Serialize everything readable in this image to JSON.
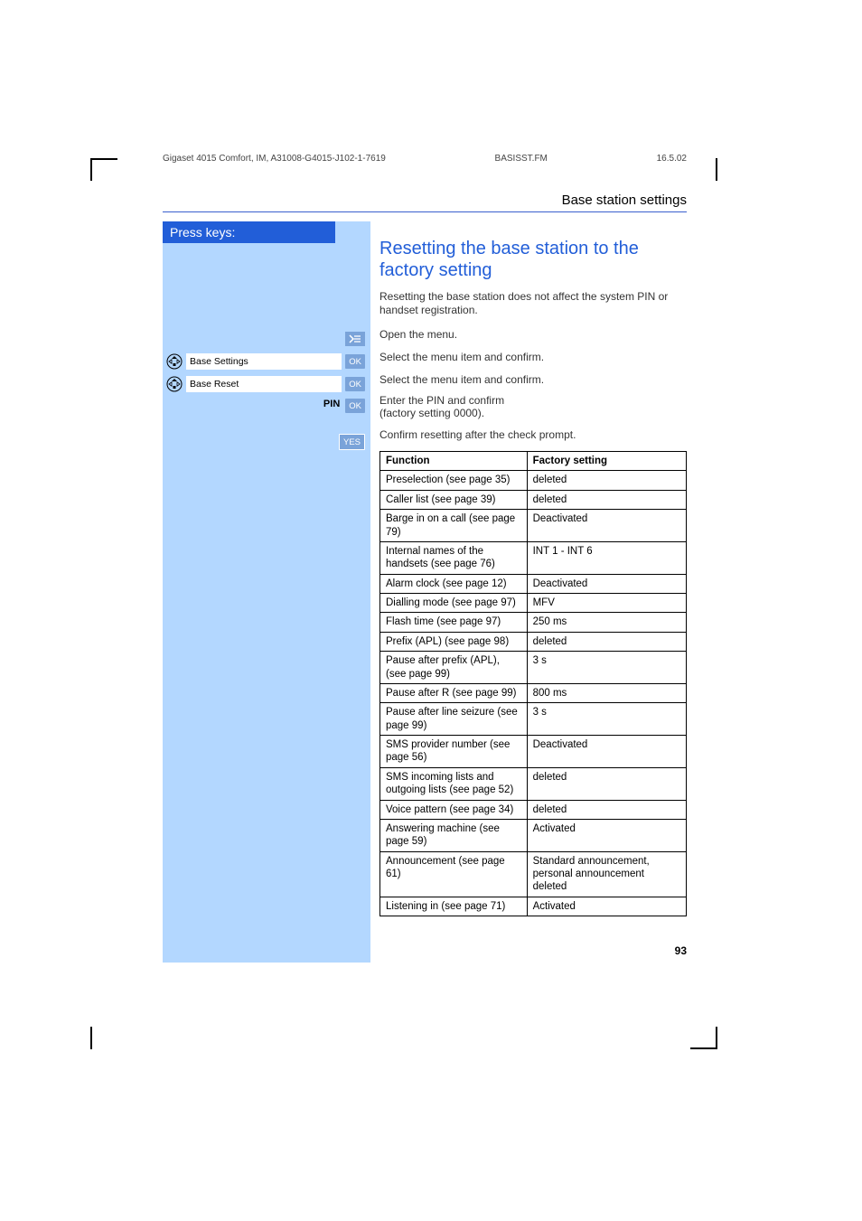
{
  "header": {
    "doc_id": "Gigaset 4015 Comfort, IM, A31008-G4015-J102-1-7619",
    "file": "BASISST.FM",
    "date": "16.5.02",
    "section_title": "Base station settings"
  },
  "sidebar": {
    "press_keys": "Press keys:",
    "steps": [
      {
        "type": "iconmenu"
      },
      {
        "type": "navfield",
        "field": "Base Settings",
        "pill": "OK"
      },
      {
        "type": "navfield",
        "field": "Base Reset",
        "pill": "OK"
      },
      {
        "type": "pin",
        "label": "PIN",
        "pill": "OK"
      },
      {
        "type": "yes",
        "pill": "YES"
      }
    ]
  },
  "main": {
    "heading": "Resetting the base station to the factory setting",
    "intro": "Resetting the base station does not affect the system PIN or handset registration.",
    "steps_text": [
      "Open the menu.",
      "Select the menu item and confirm.",
      "Select the menu item and confirm.",
      "Enter the PIN and confirm\n(factory setting 0000).",
      "Confirm resetting after the check prompt."
    ],
    "table": {
      "headers": [
        "Function",
        "Factory setting"
      ],
      "rows": [
        [
          "Preselection (see page 35)",
          "deleted"
        ],
        [
          "Caller list (see page 39)",
          "deleted"
        ],
        [
          "Barge in on a call (see page 79)",
          "Deactivated"
        ],
        [
          "Internal names of the handsets (see page 76)",
          "INT 1 - INT 6"
        ],
        [
          "Alarm clock (see page 12)",
          "Deactivated"
        ],
        [
          "Dialling mode (see page 97)",
          "MFV"
        ],
        [
          "Flash time (see page 97)",
          "250 ms"
        ],
        [
          "Prefix (APL) (see page 98)",
          "deleted"
        ],
        [
          "Pause after prefix (APL), (see page 99)",
          "3 s"
        ],
        [
          "Pause after R (see page 99)",
          "800 ms"
        ],
        [
          "Pause after line seizure (see page 99)",
          "3 s"
        ],
        [
          "SMS provider number (see page 56)",
          "Deactivated"
        ],
        [
          "SMS incoming lists and outgoing lists (see page 52)",
          "deleted"
        ],
        [
          "Voice pattern (see page 34)",
          "deleted"
        ],
        [
          "Answering machine (see page 59)",
          "Activated"
        ],
        [
          "Announcement (see page 61)",
          "Standard announcement, personal announcement deleted"
        ],
        [
          "Listening in (see page 71)",
          "Activated"
        ]
      ]
    }
  },
  "page_number": "93"
}
